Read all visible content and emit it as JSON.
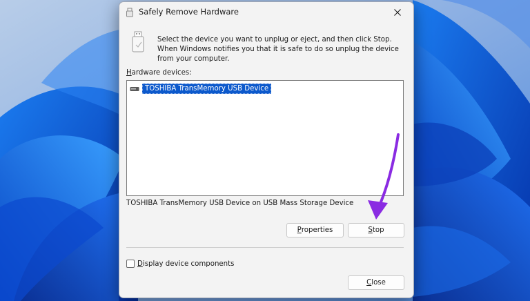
{
  "window": {
    "title": "Safely Remove Hardware",
    "close_glyph": "✕"
  },
  "instructions": "Select the device you want to unplug or eject, and then click Stop. When Windows notifies you that it is safe to do so unplug the device from your computer.",
  "hardware_devices": {
    "label_mnemonic": "H",
    "label_rest": "ardware devices:",
    "items": [
      {
        "label": "TOSHIBA TransMemory USB Device",
        "icon": "usb-drive-icon",
        "selected": true
      }
    ]
  },
  "device_description": "TOSHIBA TransMemory USB Device on USB Mass Storage Device",
  "buttons": {
    "properties": {
      "mnemonic": "P",
      "rest": "roperties"
    },
    "stop": {
      "mnemonic": "S",
      "rest": "top"
    },
    "close": {
      "mnemonic": "C",
      "rest": "lose"
    }
  },
  "display_components": {
    "mnemonic": "D",
    "rest": "isplay device components",
    "checked": false
  },
  "colors": {
    "selection": "#0c59cc",
    "annotation_arrow": "#8a2be2",
    "wallpaper_blue": "#0a3fb0"
  }
}
